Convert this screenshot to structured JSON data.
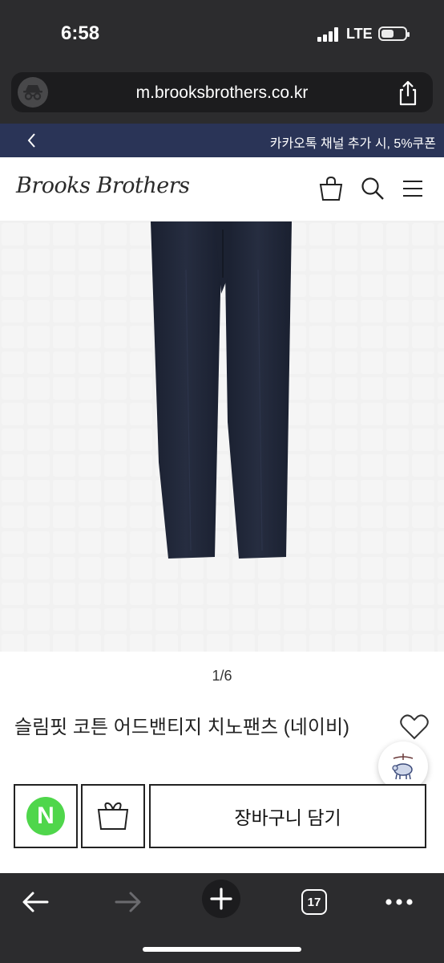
{
  "status_bar": {
    "time": "6:58",
    "network": "LTE",
    "battery_level": 0.55
  },
  "browser": {
    "url": "m.brooksbrothers.co.kr",
    "privacy_icon": "incognito-icon",
    "share_icon": "share-icon"
  },
  "promo_banner": {
    "text": "카카오톡 채널 추가 시, 5%쿠폰",
    "back_icon": "chevron-left-icon"
  },
  "header": {
    "logo": "Brooks Brothers",
    "icons": [
      "shopping-bag-icon",
      "search-icon",
      "menu-icon"
    ]
  },
  "product": {
    "image_pager": "1/6",
    "name": "슬림핏 코튼 어드밴티지 치노팬츠 (네이비)",
    "colors": {
      "pants": "#1f2535",
      "background": "#f2f2f2"
    }
  },
  "actions": {
    "npay_label": "N",
    "npay_color": "#4fd64b",
    "gift_icon": "gift-box-icon",
    "add_to_cart_label": "장바구니 담기"
  },
  "toolbar": {
    "tab_count": "17",
    "icons": [
      "back-arrow-icon",
      "forward-arrow-icon",
      "plus-icon",
      "tabs-icon",
      "more-icon"
    ]
  }
}
